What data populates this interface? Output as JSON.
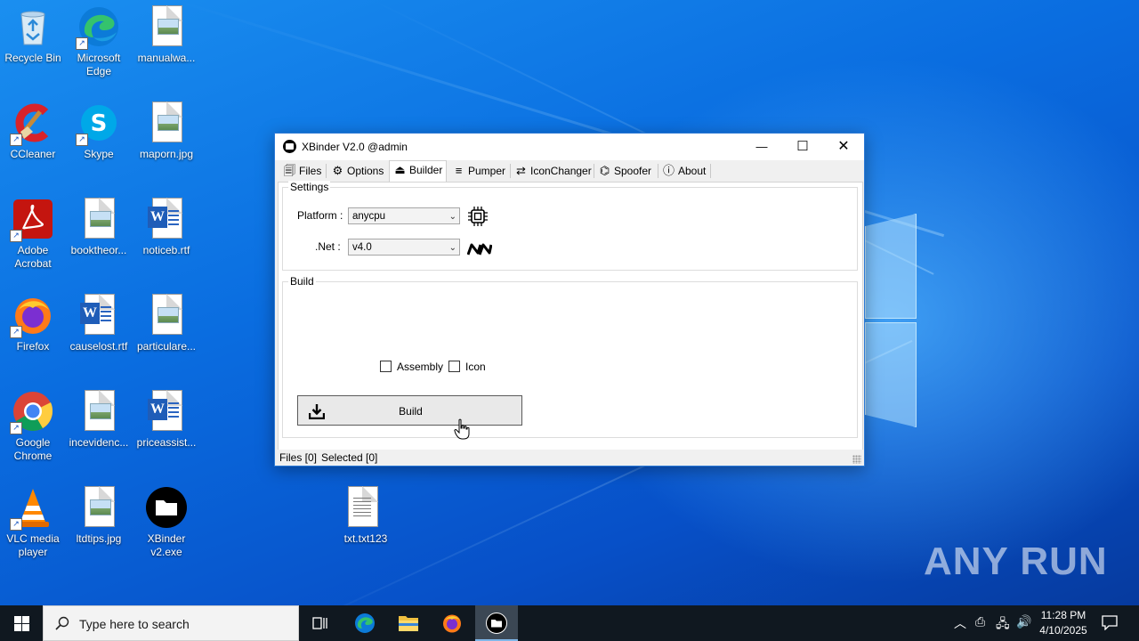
{
  "desktop": {
    "icons": [
      {
        "label": "Recycle Bin",
        "type": "recycle"
      },
      {
        "label": "Microsoft Edge",
        "type": "edge"
      },
      {
        "label": "manualwa...",
        "type": "image"
      },
      {
        "label": "CCleaner",
        "type": "ccleaner"
      },
      {
        "label": "Skype",
        "type": "skype"
      },
      {
        "label": "maporn.jpg",
        "type": "image"
      },
      {
        "label": "Adobe Acrobat",
        "type": "acrobat"
      },
      {
        "label": "booktheor...",
        "type": "image"
      },
      {
        "label": "noticeb.rtf",
        "type": "word"
      },
      {
        "label": "Firefox",
        "type": "firefox"
      },
      {
        "label": "causelost.rtf",
        "type": "word"
      },
      {
        "label": "particulare...",
        "type": "image"
      },
      {
        "label": "Google Chrome",
        "type": "chrome"
      },
      {
        "label": "incevidenc...",
        "type": "image"
      },
      {
        "label": "priceassist...",
        "type": "word"
      },
      {
        "label": "VLC media player",
        "type": "vlc"
      },
      {
        "label": "ltdtips.jpg",
        "type": "image"
      },
      {
        "label": "XBinder v2.exe",
        "type": "xbinder"
      },
      {
        "label": "txt.txt123",
        "type": "text"
      }
    ]
  },
  "window": {
    "title": "XBinder V2.0 @admin",
    "controls": {
      "minimize": "—",
      "maximize": "☐",
      "close": "✕"
    },
    "tabs": [
      {
        "label": "Files",
        "icon": "files-icon"
      },
      {
        "label": "Options",
        "icon": "gear-icon"
      },
      {
        "label": "Builder",
        "icon": "builder-icon",
        "active": true
      },
      {
        "label": "Pumper",
        "icon": "pumper-icon"
      },
      {
        "label": "IconChanger",
        "icon": "swap-icon"
      },
      {
        "label": "Spoofer",
        "icon": "spoofer-icon"
      },
      {
        "label": "About",
        "icon": "info-icon"
      }
    ],
    "settings": {
      "title": "Settings",
      "platform_label": "Platform :",
      "platform_value": "anycpu",
      "net_label": ".Net :",
      "net_value": "v4.0"
    },
    "build": {
      "title": "Build",
      "assembly_label": "Assembly",
      "assembly_checked": false,
      "icon_label": "Icon",
      "icon_checked": false,
      "button_label": "Build"
    },
    "status": {
      "files": "Files [0]",
      "selected": "Selected [0]"
    }
  },
  "taskbar": {
    "search_placeholder": "Type here to search",
    "time": "11:28 PM",
    "date": "4/10/2025"
  },
  "watermark": "ANY RUN"
}
